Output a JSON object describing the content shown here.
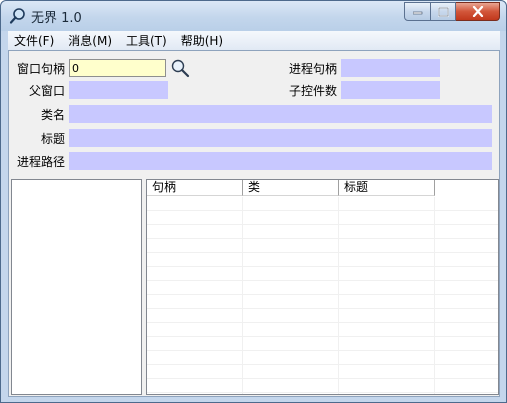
{
  "window": {
    "title": "无界 1.0",
    "colors": {
      "field": "#c8c8ff",
      "input": "#ffffcc",
      "close": "#c1381c"
    }
  },
  "caption_buttons": {
    "min_icon": "minimize-icon",
    "max_icon": "maximize-icon",
    "close_icon": "close-icon"
  },
  "menu": {
    "items": [
      {
        "label": "文件(F)"
      },
      {
        "label": "消息(M)"
      },
      {
        "label": "工具(T)"
      },
      {
        "label": "帮助(H)"
      }
    ]
  },
  "form": {
    "window_handle_label": "窗口句柄",
    "window_handle_value": "0",
    "find_icon": "magnifier-icon",
    "process_handle_label": "进程句柄",
    "parent_window_label": "父窗口",
    "child_count_label": "子控件数",
    "class_name_label": "类名",
    "title_label": "标题",
    "process_path_label": "进程路径"
  },
  "list": {
    "columns": [
      "句柄",
      "类",
      "标题"
    ]
  }
}
